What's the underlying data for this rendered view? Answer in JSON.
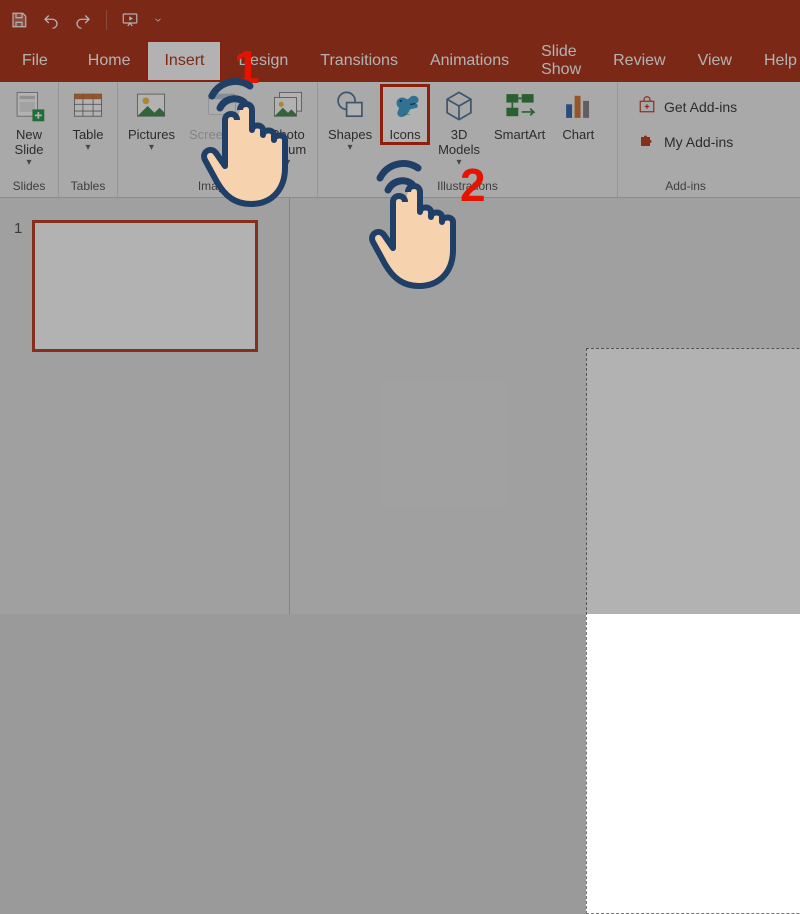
{
  "qat": {
    "save": "Save",
    "undo": "Undo",
    "redo": "Redo",
    "slideshow": "Start From Beginning"
  },
  "tabs": {
    "file": "File",
    "home": "Home",
    "insert": "Insert",
    "design": "Design",
    "transitions": "Transitions",
    "animations": "Animations",
    "slideshow": "Slide Show",
    "review": "Review",
    "view": "View",
    "help": "Help"
  },
  "ribbon": {
    "slides": {
      "new_slide": "New\nSlide",
      "group": "Slides"
    },
    "tables": {
      "table": "Table",
      "group": "Tables"
    },
    "images": {
      "pictures": "Pictures",
      "screenshot": "Screenshot",
      "photo_album": "Photo\nAlbum",
      "group": "Images"
    },
    "illustrations": {
      "shapes": "Shapes",
      "icons": "Icons",
      "models3d": "3D\nModels",
      "smartart": "SmartArt",
      "chart": "Chart",
      "group": "Illustrations"
    },
    "addins": {
      "get": "Get Add-ins",
      "my": "My Add-ins",
      "group": "Add-ins"
    }
  },
  "thumbs": {
    "n1": "1"
  },
  "annotations": {
    "step1": "1",
    "step2": "2"
  }
}
